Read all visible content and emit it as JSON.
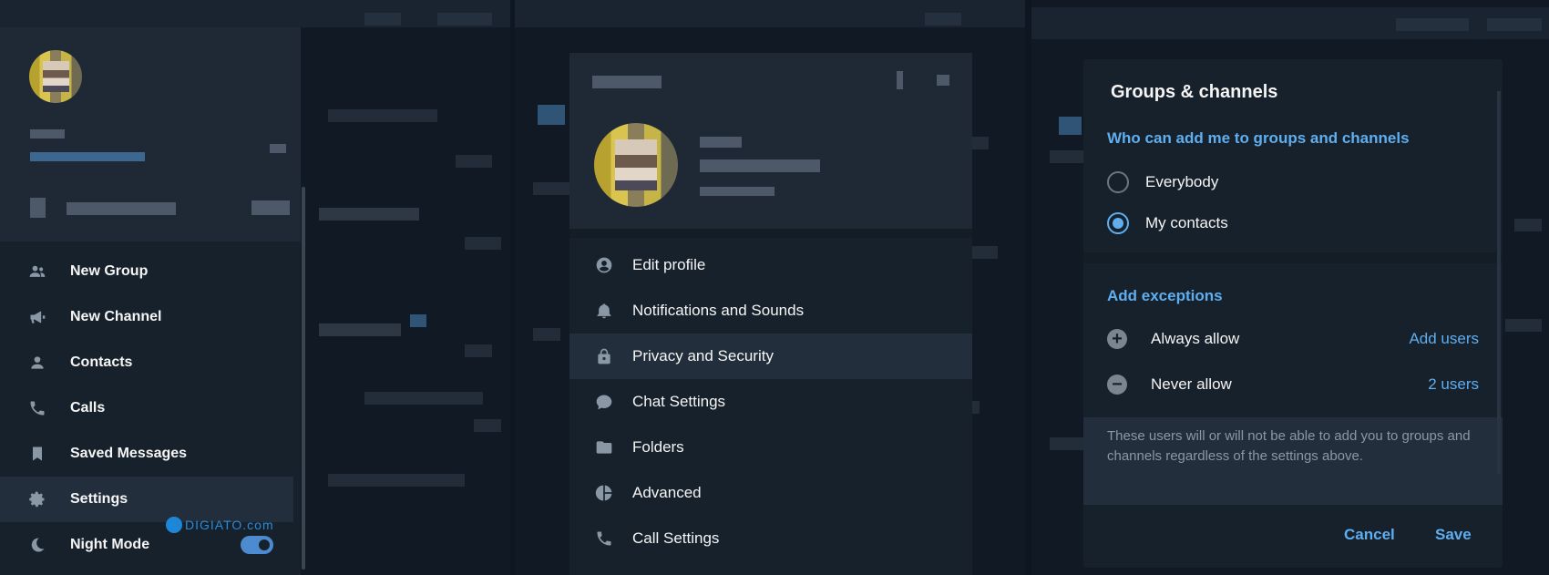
{
  "left_menu": {
    "items": [
      {
        "label": "New Group",
        "icon": "people-icon"
      },
      {
        "label": "New Channel",
        "icon": "megaphone-icon"
      },
      {
        "label": "Contacts",
        "icon": "person-icon"
      },
      {
        "label": "Calls",
        "icon": "phone-icon"
      },
      {
        "label": "Saved Messages",
        "icon": "bookmark-icon"
      },
      {
        "label": "Settings",
        "icon": "gear-icon"
      },
      {
        "label": "Night Mode",
        "icon": "moon-icon"
      }
    ],
    "night_mode_on": true,
    "watermark": "DIGIATO.com"
  },
  "settings": {
    "items": [
      {
        "label": "Edit profile",
        "icon": "profile-icon"
      },
      {
        "label": "Notifications and Sounds",
        "icon": "bell-icon"
      },
      {
        "label": "Privacy and Security",
        "icon": "lock-icon"
      },
      {
        "label": "Chat Settings",
        "icon": "chat-icon"
      },
      {
        "label": "Folders",
        "icon": "folder-icon"
      },
      {
        "label": "Advanced",
        "icon": "pie-icon"
      },
      {
        "label": "Call Settings",
        "icon": "phone-icon"
      }
    ]
  },
  "groups_dialog": {
    "title": "Groups & channels",
    "who_can_add": "Who can add me to groups and channels",
    "options": [
      {
        "label": "Everybody",
        "selected": false
      },
      {
        "label": "My contacts",
        "selected": true
      }
    ],
    "exceptions_title": "Add exceptions",
    "always_allow": {
      "label": "Always allow",
      "value": "Add users"
    },
    "never_allow": {
      "label": "Never allow",
      "value": "2 users"
    },
    "note": "These users will or will not be able to add you to groups and channels regardless of the settings above.",
    "cancel": "Cancel",
    "save": "Save"
  },
  "colors": {
    "accent": "#5eaef0",
    "panel": "#17212b",
    "toggle": "#4c8bcf"
  }
}
